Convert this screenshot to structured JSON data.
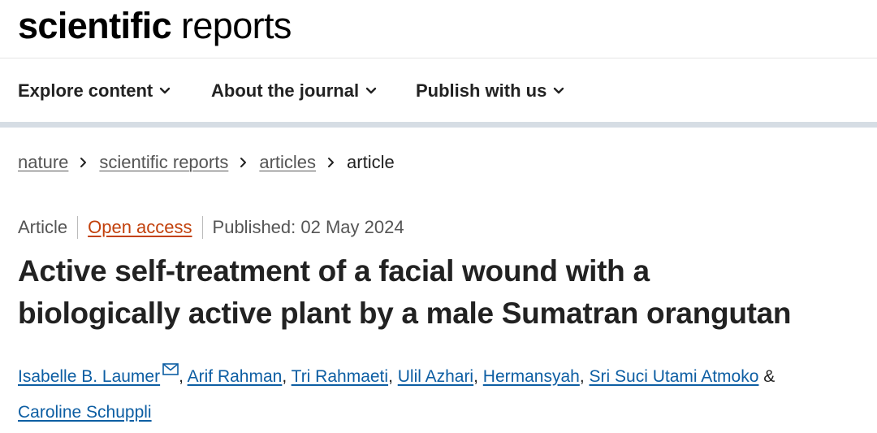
{
  "logo": {
    "bold": "scientific",
    "light": " reports"
  },
  "nav": {
    "items": [
      {
        "label": "Explore content"
      },
      {
        "label": "About the journal"
      },
      {
        "label": "Publish with us"
      }
    ]
  },
  "breadcrumb": {
    "items": [
      "nature",
      "scientific reports",
      "articles"
    ],
    "current": "article"
  },
  "meta": {
    "type": "Article",
    "access": "Open access",
    "published": "Published: 02 May 2024"
  },
  "article": {
    "title_line1": "Active self-treatment of a facial wound with a",
    "title_line2": "biologically active plant by a male Sumatran orangutan"
  },
  "authors": {
    "list": [
      "Isabelle B. Laumer",
      "Arif Rahman",
      "Tri Rahmaeti",
      "Ulil Azhari",
      "Hermansyah",
      "Sri Suci Utami Atmoko",
      "Caroline Schuppli"
    ],
    "ampersand": "&"
  },
  "colors": {
    "link": "#0d5ea3",
    "open_access": "#c2410c",
    "nav_divider": "#d6dde4"
  }
}
